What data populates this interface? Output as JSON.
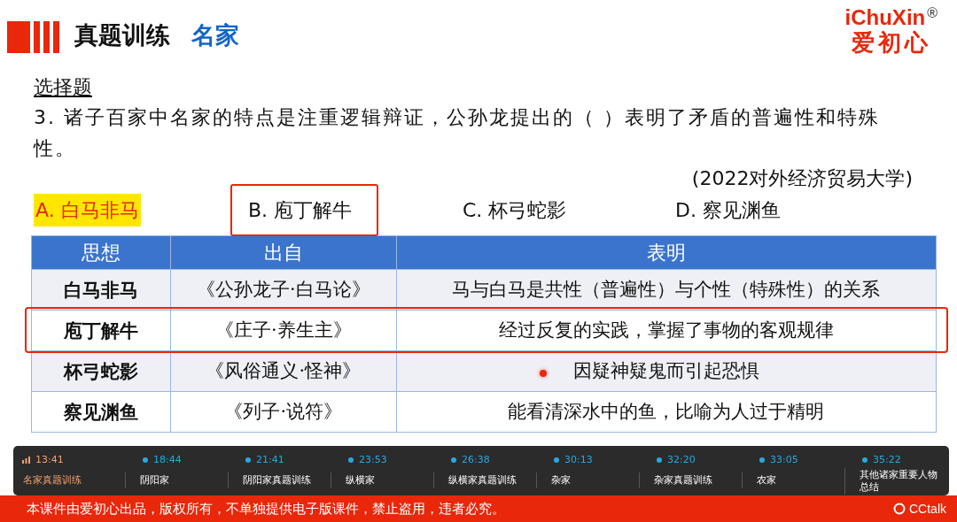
{
  "header": {
    "title": "真题训练",
    "subtitle": "名家",
    "logo": {
      "brand": "iChuXin",
      "mark": "®",
      "name": "爱初心"
    }
  },
  "question": {
    "section": "选择题",
    "text": "3. 诸子百家中名家的特点是注重逻辑辩证，公孙龙提出的（    ）表明了矛盾的普遍性和特殊性。",
    "source": "(2022对外经济贸易大学)",
    "options": [
      {
        "label": "A. 白马非马",
        "selected": true,
        "boxed": false
      },
      {
        "label": "B. 庖丁解牛",
        "selected": false,
        "boxed": true
      },
      {
        "label": "C. 杯弓蛇影",
        "selected": false,
        "boxed": false
      },
      {
        "label": "D. 察见渊鱼",
        "selected": false,
        "boxed": false
      }
    ]
  },
  "table": {
    "columns": [
      "思想",
      "出自",
      "表明"
    ],
    "rows": [
      {
        "cells": [
          "白马非马",
          "《公孙龙子·白马论》",
          "马与白马是共性（普遍性）与个性（特殊性）的关系"
        ],
        "boxed": false
      },
      {
        "cells": [
          "庖丁解牛",
          "《庄子·养生主》",
          "经过反复的实践，掌握了事物的客观规律"
        ],
        "boxed": true
      },
      {
        "cells": [
          "杯弓蛇影",
          "《风俗通义·怪神》",
          "因疑神疑鬼而引起恐惧"
        ],
        "boxed": false
      },
      {
        "cells": [
          "察见渊鱼",
          "《列子·说符》",
          "能看清深水中的鱼，比喻为人过于精明"
        ],
        "boxed": false
      }
    ]
  },
  "footer": {
    "text": "本课件由爱初心出品，版权所有，不单独提供电子版课件，禁止盗用，违者必究。",
    "brand": "CCtalk"
  },
  "player": {
    "chapters": [
      {
        "time": "13:41",
        "label": "名家真题训练",
        "selected": true
      },
      {
        "time": "18:44",
        "label": "阴阳家",
        "selected": false
      },
      {
        "time": "21:41",
        "label": "阴阳家真题训练",
        "selected": false
      },
      {
        "time": "23:53",
        "label": "纵横家",
        "selected": false
      },
      {
        "time": "26:38",
        "label": "纵横家真题训练",
        "selected": false
      },
      {
        "time": "30:13",
        "label": "杂家",
        "selected": false
      },
      {
        "time": "32:20",
        "label": "杂家真题训练",
        "selected": false
      },
      {
        "time": "33:05",
        "label": "农家",
        "selected": false
      },
      {
        "time": "35:22",
        "label": "其他诸家重要人物总结",
        "selected": false
      }
    ]
  }
}
